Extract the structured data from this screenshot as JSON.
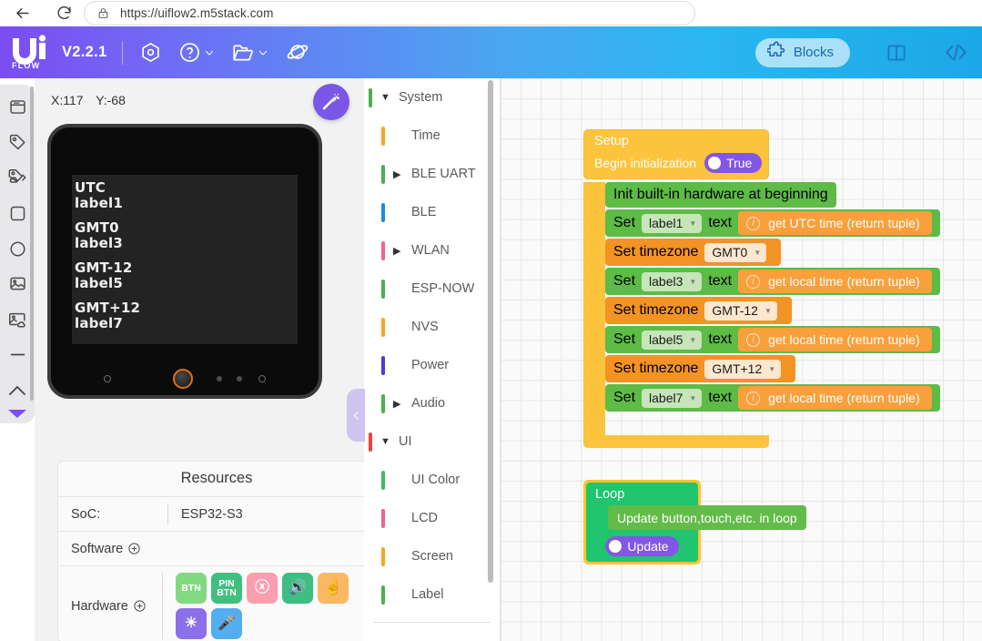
{
  "browser": {
    "back_label": "back-arrow",
    "reload_label": "reload",
    "lock_label": "site-lock",
    "url": "https://uiflow2.m5stack.com"
  },
  "toolbar": {
    "brand": "Ui",
    "brand_sub": "FLOW",
    "version": "V2.2.1",
    "icons": [
      "hex-target-icon",
      "help-icon",
      "folder-icon",
      "planet-icon"
    ],
    "blocks_tab": "Blocks",
    "layout_icon": "split-panel-icon",
    "code_icon": "code-brackets-icon"
  },
  "rail": {
    "items": [
      "window-icon",
      "tag-icon",
      "tag-cloud-icon",
      "square-icon",
      "circle-icon",
      "image-icon",
      "image-cloud-icon",
      "line-icon",
      "chevron-up-icon"
    ]
  },
  "simulator": {
    "coord_x": "X:117",
    "coord_y": "Y:-68",
    "fab_icon": "magic-wand-icon",
    "screen_lines": [
      "UTC",
      "label1",
      "",
      "GMT0",
      "label3",
      "",
      "GMT-12",
      "label5",
      "",
      "GMT+12",
      "label7"
    ]
  },
  "resources": {
    "title": "Resources",
    "soc_key": "SoC:",
    "soc_value": "ESP32-S3",
    "software_key": "Software",
    "hardware_key": "Hardware",
    "chips": [
      {
        "label": "BTN",
        "sublabel": "",
        "icon": "",
        "color": "#82d982"
      },
      {
        "label": "PIN",
        "sublabel": "BTN",
        "icon": "",
        "color": "#3fc07e"
      },
      {
        "label": "",
        "sublabel": "",
        "icon": "ⓧ",
        "color": "#fb9eb0"
      },
      {
        "label": "",
        "sublabel": "",
        "icon": "🔊",
        "color": "#3fbd84"
      },
      {
        "label": "",
        "sublabel": "",
        "icon": "☝",
        "color": "#f9b861"
      },
      {
        "label": "",
        "sublabel": "",
        "icon": "☀",
        "color": "#8b70ea"
      },
      {
        "label": "",
        "sublabel": "",
        "icon": "🎤",
        "color": "#53aef0"
      }
    ]
  },
  "categories": {
    "flyout_handle_icon": "chevron-left-icon",
    "items": [
      {
        "label": "System",
        "color": "#4caf50",
        "arrow": "down",
        "indent": false
      },
      {
        "label": "Time",
        "color": "#f5a623",
        "arrow": "none",
        "indent": true
      },
      {
        "label": "BLE UART",
        "color": "#4caf50",
        "arrow": "right",
        "indent": true
      },
      {
        "label": "BLE",
        "color": "#1e88e5",
        "arrow": "none",
        "indent": true
      },
      {
        "label": "WLAN",
        "color": "#f06292",
        "arrow": "right",
        "indent": true
      },
      {
        "label": "ESP-NOW",
        "color": "#4caf50",
        "arrow": "none",
        "indent": true
      },
      {
        "label": "NVS",
        "color": "#f5a623",
        "arrow": "none",
        "indent": true
      },
      {
        "label": "Power",
        "color": "#5138d8",
        "arrow": "none",
        "indent": true
      },
      {
        "label": "Audio",
        "color": "#4caf50",
        "arrow": "right",
        "indent": true
      },
      {
        "label": "UI",
        "color": "#f44336",
        "arrow": "down",
        "indent": false
      },
      {
        "label": "UI Color",
        "color": "#3fbd6a",
        "arrow": "none",
        "indent": true
      },
      {
        "label": "LCD",
        "color": "#f06292",
        "arrow": "none",
        "indent": true
      },
      {
        "label": "Screen",
        "color": "#f5a623",
        "arrow": "none",
        "indent": true
      },
      {
        "label": "Label",
        "color": "#4caf50",
        "arrow": "none",
        "indent": true
      }
    ]
  },
  "workspace": {
    "setup": {
      "title": "Setup",
      "init_label": "Begin initialization",
      "init_value": "True",
      "rows": [
        {
          "kind": "green_plain",
          "text": "Init built-in hardware at beginning"
        },
        {
          "kind": "set_text",
          "set": "Set",
          "field": "label1",
          "text_label": "text",
          "value": "get UTC time (return tuple)"
        },
        {
          "kind": "timezone",
          "set": "Set timezone",
          "field": "GMT0"
        },
        {
          "kind": "set_text",
          "set": "Set",
          "field": "label3",
          "text_label": "text",
          "value": "get local time (return tuple)"
        },
        {
          "kind": "timezone",
          "set": "Set timezone",
          "field": "GMT-12"
        },
        {
          "kind": "set_text",
          "set": "Set",
          "field": "label5",
          "text_label": "text",
          "value": "get local time (return tuple)"
        },
        {
          "kind": "timezone",
          "set": "Set timezone",
          "field": "GMT+12"
        },
        {
          "kind": "set_text",
          "set": "Set",
          "field": "label7",
          "text_label": "text",
          "value": "get local time (return tuple)"
        }
      ]
    },
    "loop": {
      "title": "Loop",
      "statement": "Update button,touch,etc. in loop",
      "toggle": "Update"
    }
  }
}
